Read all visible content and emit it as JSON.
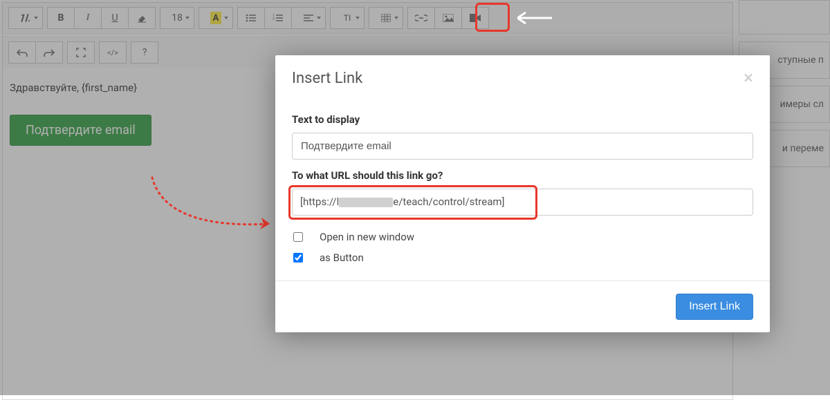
{
  "toolbar": {
    "font_size_label": "18",
    "text_color_letter": "A",
    "remove_format_label": "TI"
  },
  "second_toolbar": {
    "help_label": "?",
    "code_label": "</>"
  },
  "editor": {
    "greeting": "Здравствуйте, {first_name}",
    "confirm_button": "Подтвердите email"
  },
  "sidebar": {
    "item1": "ступные п",
    "item2": "имеры сл",
    "item3": "и переме"
  },
  "modal": {
    "title": "Insert Link",
    "text_label": "Text to display",
    "text_value": "Подтвердите email",
    "url_label": "To what URL should this link go?",
    "url_prefix": "[https://l",
    "url_suffix": "e/teach/control/stream]",
    "open_new_window_label": "Open in new window",
    "as_button_label": "as Button",
    "submit_label": "Insert Link",
    "open_new_window_checked": false,
    "as_button_checked": true
  }
}
